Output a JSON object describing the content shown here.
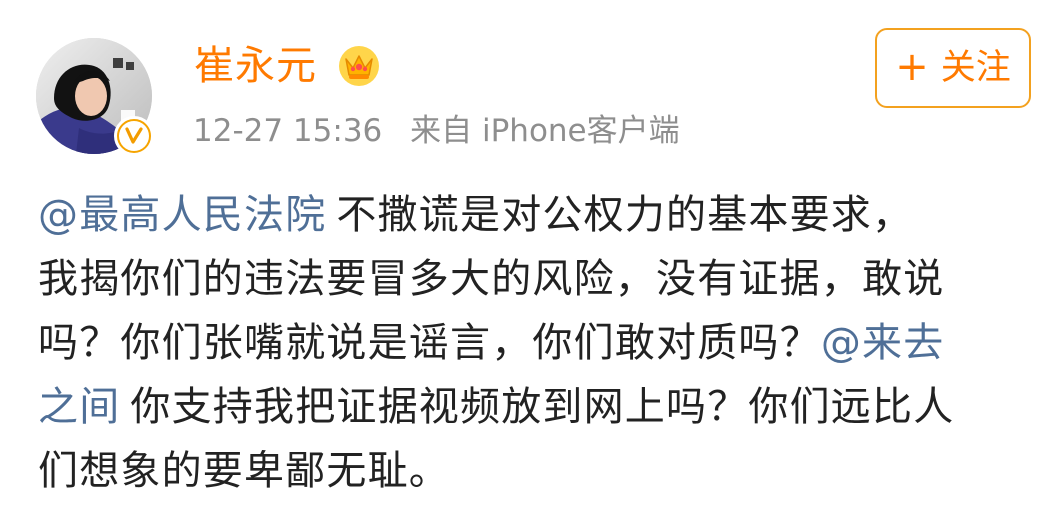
{
  "profile": {
    "username": "崔永元",
    "timestamp": "12-27 15:36",
    "source_text": "来自 iPhone客户端",
    "avatar_icon": "user-avatar-photo",
    "verified_badge_icon": "verified-badge-icon",
    "crown_icon": "crown-icon",
    "colors": {
      "username": "#ff7a00",
      "follow_border": "#f3a11f",
      "mention": "#4f6f97",
      "meta": "#8e8e8e"
    }
  },
  "follow_button": {
    "plus": "+",
    "label": "关注"
  },
  "post": {
    "line1": {
      "mention": "@最高人民法院",
      "text": "不撒谎是对公权力的基本要求，"
    },
    "line2": "我揭你们的违法要冒多大的风险，没有证据，敢说",
    "line3": {
      "text": "吗？你们张嘴就说是谣言，你们敢对质吗？",
      "mention": "@来去"
    },
    "line4": {
      "mention": "之间",
      "text": "你支持我把证据视频放到网上吗？你们远比人"
    },
    "line5": "们想象的要卑鄙无耻。"
  }
}
